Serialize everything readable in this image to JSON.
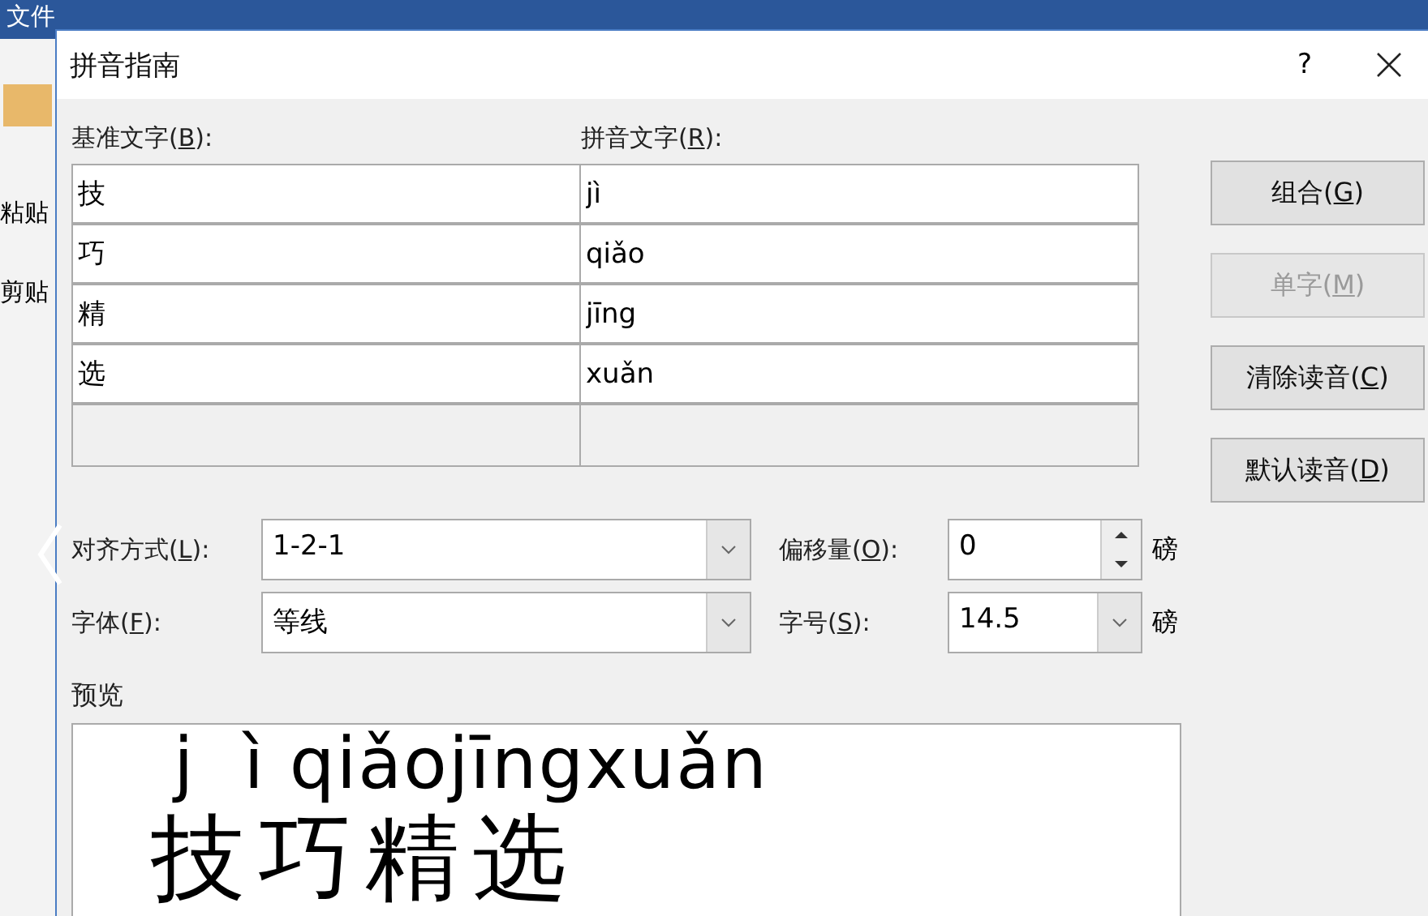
{
  "background_app": {
    "ribbon_tab": "文件",
    "clipboard_labels": [
      "粘贴",
      "剪贴"
    ]
  },
  "dialog": {
    "title": "拼音指南",
    "help": "?",
    "base_label": {
      "prefix": "基准文字(",
      "key": "B",
      "suffix": "):"
    },
    "ruby_label": {
      "prefix": "拼音文字(",
      "key": "R",
      "suffix": "):"
    },
    "rows": [
      {
        "base": "技",
        "ruby": "jì"
      },
      {
        "base": "巧",
        "ruby": "qiǎo"
      },
      {
        "base": "精",
        "ruby": "jīng"
      },
      {
        "base": "选",
        "ruby": "xuǎn"
      }
    ],
    "buttons": [
      {
        "prefix": "组合(",
        "key": "G",
        "suffix": ")",
        "disabled": false
      },
      {
        "prefix": "单字(",
        "key": "M",
        "suffix": ")",
        "disabled": true
      },
      {
        "prefix": "清除读音(",
        "key": "C",
        "suffix": ")",
        "disabled": false
      },
      {
        "prefix": "默认读音(",
        "key": "D",
        "suffix": ")",
        "disabled": false
      }
    ],
    "alignment": {
      "label": {
        "prefix": "对齐方式(",
        "key": "L",
        "suffix": "):"
      },
      "value": "1-2-1"
    },
    "font": {
      "label": {
        "prefix": "字体(",
        "key": "F",
        "suffix": "):"
      },
      "value": "等线"
    },
    "offset": {
      "label": {
        "prefix": "偏移量(",
        "key": "O",
        "suffix": "):"
      },
      "value": "0",
      "unit": "磅"
    },
    "size": {
      "label": {
        "prefix": "字号(",
        "key": "S",
        "suffix": "):"
      },
      "value": "14.5",
      "unit": "磅"
    },
    "preview": {
      "label": "预览",
      "ruby_line": "j  ì qiǎojīngxuǎn",
      "base_line": "技巧精选"
    }
  }
}
